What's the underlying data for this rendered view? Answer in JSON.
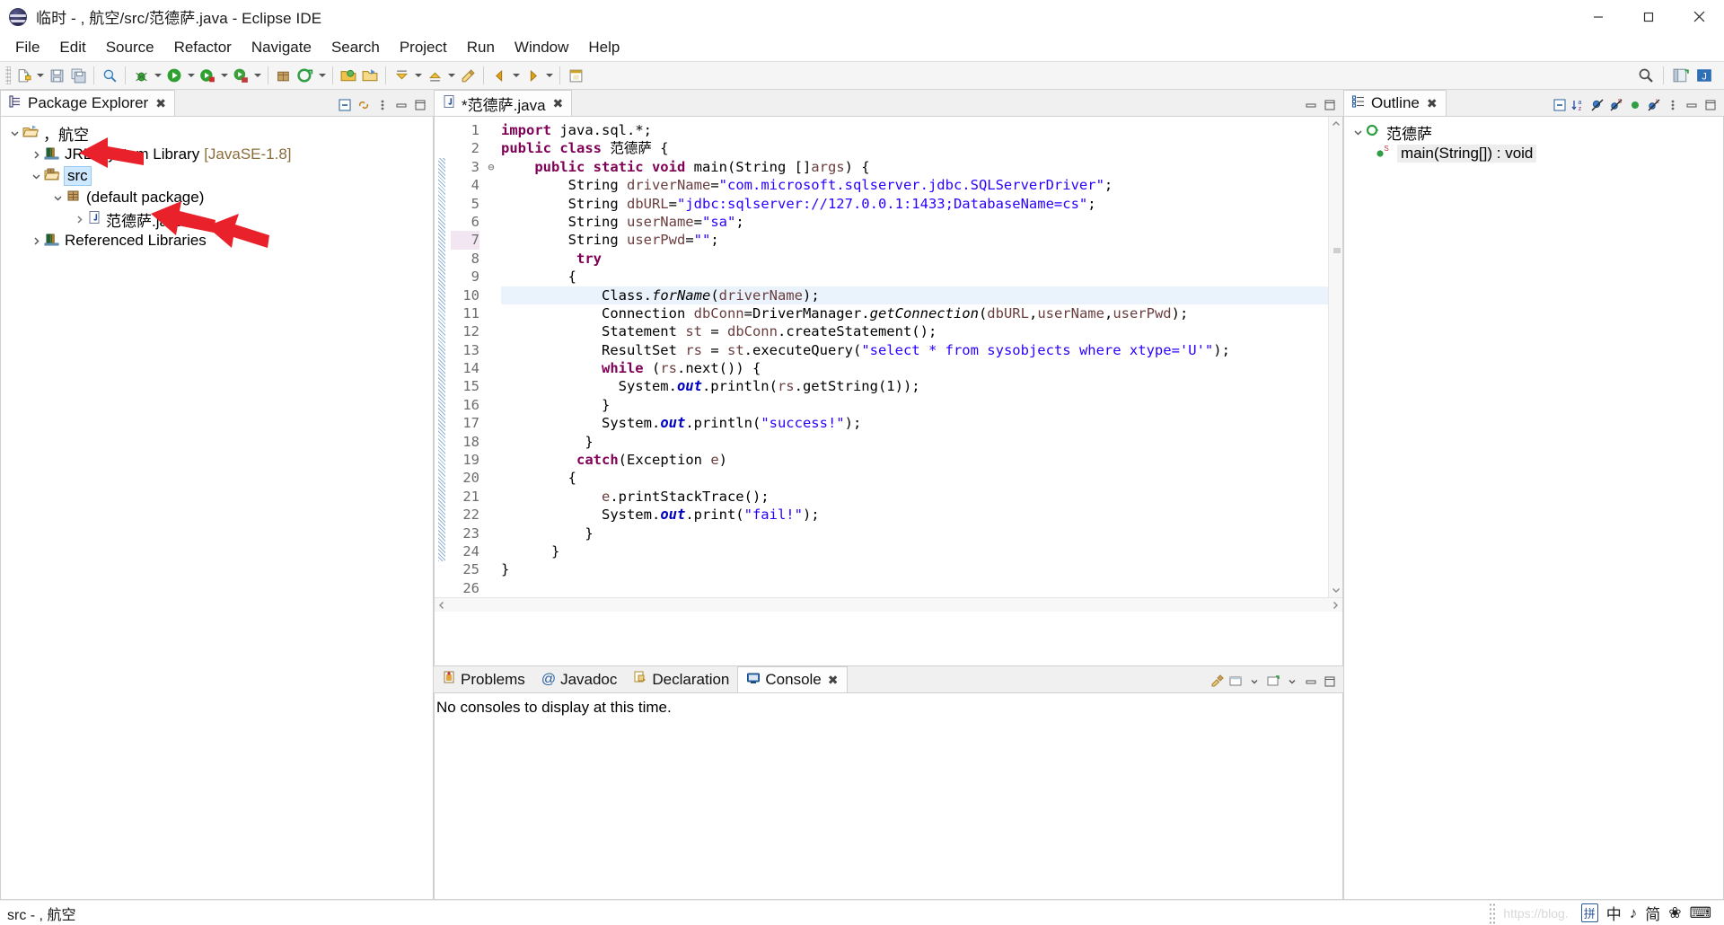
{
  "window": {
    "title": "临时 - ,  航空/src/范德萨.java - Eclipse IDE",
    "icon": "eclipse-icon",
    "minimize": "minimize-button",
    "maximize": "maximize-button",
    "close": "close-button"
  },
  "menubar": {
    "items": [
      "File",
      "Edit",
      "Source",
      "Refactor",
      "Navigate",
      "Search",
      "Project",
      "Run",
      "Window",
      "Help"
    ]
  },
  "package_explorer": {
    "tab_label": "Package Explorer",
    "tree": [
      {
        "label": "，航空",
        "icon": "project-folder-icon",
        "indent": 0,
        "expanded": true,
        "selected": false
      },
      {
        "label": "JRE System Library",
        "suffix": "[JavaSE-1.8]",
        "icon": "library-icon",
        "indent": 1,
        "expanded": false,
        "selected": false
      },
      {
        "label": "src",
        "icon": "source-folder-icon",
        "indent": 1,
        "expanded": true,
        "selected": true
      },
      {
        "label": "(default package)",
        "icon": "package-icon",
        "indent": 2,
        "expanded": true,
        "selected": false
      },
      {
        "label": "范德萨.java",
        "icon": "java-file-icon",
        "indent": 3,
        "expanded": false,
        "selected": false
      },
      {
        "label": "Referenced Libraries",
        "icon": "library-icon",
        "indent": 1,
        "expanded": false,
        "selected": false
      }
    ]
  },
  "editor": {
    "tab_label": "*范德萨.java",
    "dirty": true,
    "current_line": 7,
    "highlight_line": 10,
    "lines": [
      {
        "n": 1,
        "fold": "",
        "tokens": [
          [
            "kw",
            "import"
          ],
          [
            "plain",
            " java.sql.*;"
          ]
        ]
      },
      {
        "n": 2,
        "fold": "",
        "tokens": [
          [
            "kw",
            "public class"
          ],
          [
            "plain",
            " 范德萨 {"
          ]
        ]
      },
      {
        "n": 3,
        "fold": "⊖",
        "tokens": [
          [
            "plain",
            "    "
          ],
          [
            "kw",
            "public static void"
          ],
          [
            "plain",
            " main(String []"
          ],
          [
            "lvar",
            "args"
          ],
          [
            "plain",
            ") {"
          ]
        ]
      },
      {
        "n": 4,
        "fold": "",
        "tokens": [
          [
            "plain",
            "        String "
          ],
          [
            "lvar",
            "driverName"
          ],
          [
            "plain",
            "="
          ],
          [
            "str",
            "\"com.microsoft.sqlserver.jdbc.SQLServerDriver\""
          ],
          [
            "plain",
            ";"
          ]
        ]
      },
      {
        "n": 5,
        "fold": "",
        "tokens": [
          [
            "plain",
            "        String "
          ],
          [
            "lvar",
            "dbURL"
          ],
          [
            "plain",
            "="
          ],
          [
            "str",
            "\"jdbc:sqlserver://127.0.0.1:1433;DatabaseName=cs\""
          ],
          [
            "plain",
            ";"
          ]
        ]
      },
      {
        "n": 6,
        "fold": "",
        "tokens": [
          [
            "plain",
            "        String "
          ],
          [
            "lvar",
            "userName"
          ],
          [
            "plain",
            "="
          ],
          [
            "str",
            "\"sa\""
          ],
          [
            "plain",
            ";"
          ]
        ]
      },
      {
        "n": 7,
        "fold": "",
        "tokens": [
          [
            "plain",
            "        String "
          ],
          [
            "lvar",
            "userPwd"
          ],
          [
            "plain",
            "="
          ],
          [
            "str",
            "\"\""
          ],
          [
            "plain",
            ";"
          ]
        ]
      },
      {
        "n": 8,
        "fold": "",
        "tokens": [
          [
            "plain",
            "         "
          ],
          [
            "kw",
            "try"
          ]
        ]
      },
      {
        "n": 9,
        "fold": "",
        "tokens": [
          [
            "plain",
            "        {"
          ]
        ]
      },
      {
        "n": 10,
        "fold": "",
        "tokens": [
          [
            "plain",
            "            Class."
          ],
          [
            "mth",
            "forName"
          ],
          [
            "plain",
            "("
          ],
          [
            "lvar",
            "driverName"
          ],
          [
            "plain",
            ");"
          ]
        ]
      },
      {
        "n": 11,
        "fold": "",
        "tokens": [
          [
            "plain",
            "            Connection "
          ],
          [
            "lvar",
            "dbConn"
          ],
          [
            "plain",
            "=DriverManager."
          ],
          [
            "mth",
            "getConnection"
          ],
          [
            "plain",
            "("
          ],
          [
            "lvar",
            "dbURL"
          ],
          [
            "plain",
            ","
          ],
          [
            "lvar",
            "userName"
          ],
          [
            "plain",
            ","
          ],
          [
            "lvar",
            "userPwd"
          ],
          [
            "plain",
            ");"
          ]
        ]
      },
      {
        "n": 12,
        "fold": "",
        "tokens": [
          [
            "plain",
            "            Statement "
          ],
          [
            "lvar",
            "st"
          ],
          [
            "plain",
            " = "
          ],
          [
            "lvar",
            "dbConn"
          ],
          [
            "plain",
            ".createStatement();"
          ]
        ]
      },
      {
        "n": 13,
        "fold": "",
        "tokens": [
          [
            "plain",
            "            ResultSet "
          ],
          [
            "lvar",
            "rs"
          ],
          [
            "plain",
            " = "
          ],
          [
            "lvar",
            "st"
          ],
          [
            "plain",
            ".executeQuery("
          ],
          [
            "str",
            "\"select * from sysobjects where xtype='U'\""
          ],
          [
            "plain",
            ");"
          ]
        ]
      },
      {
        "n": 14,
        "fold": "",
        "tokens": [
          [
            "plain",
            "            "
          ],
          [
            "kw",
            "while"
          ],
          [
            "plain",
            " ("
          ],
          [
            "lvar",
            "rs"
          ],
          [
            "plain",
            ".next()) {"
          ]
        ]
      },
      {
        "n": 15,
        "fold": "",
        "tokens": [
          [
            "plain",
            "              System."
          ],
          [
            "sfield",
            "out"
          ],
          [
            "plain",
            ".println("
          ],
          [
            "lvar",
            "rs"
          ],
          [
            "plain",
            ".getString(1));"
          ]
        ]
      },
      {
        "n": 16,
        "fold": "",
        "tokens": [
          [
            "plain",
            "            }"
          ]
        ]
      },
      {
        "n": 17,
        "fold": "",
        "tokens": [
          [
            "plain",
            "            System."
          ],
          [
            "sfield",
            "out"
          ],
          [
            "plain",
            ".println("
          ],
          [
            "str",
            "\"success!\""
          ],
          [
            "plain",
            ");"
          ]
        ]
      },
      {
        "n": 18,
        "fold": "",
        "tokens": [
          [
            "plain",
            "          }"
          ]
        ]
      },
      {
        "n": 19,
        "fold": "",
        "tokens": [
          [
            "plain",
            "         "
          ],
          [
            "kw",
            "catch"
          ],
          [
            "plain",
            "(Exception "
          ],
          [
            "lvar",
            "e"
          ],
          [
            "plain",
            ")"
          ]
        ]
      },
      {
        "n": 20,
        "fold": "",
        "tokens": [
          [
            "plain",
            "        {"
          ]
        ]
      },
      {
        "n": 21,
        "fold": "",
        "tokens": [
          [
            "plain",
            "            "
          ],
          [
            "lvar",
            "e"
          ],
          [
            "plain",
            ".printStackTrace();"
          ]
        ]
      },
      {
        "n": 22,
        "fold": "",
        "tokens": [
          [
            "plain",
            "            System."
          ],
          [
            "sfield",
            "out"
          ],
          [
            "plain",
            ".print("
          ],
          [
            "str",
            "\"fail!\""
          ],
          [
            "plain",
            ");"
          ]
        ]
      },
      {
        "n": 23,
        "fold": "",
        "tokens": [
          [
            "plain",
            "          }"
          ]
        ]
      },
      {
        "n": 24,
        "fold": "",
        "tokens": [
          [
            "plain",
            "      }"
          ]
        ]
      },
      {
        "n": 25,
        "fold": "",
        "tokens": [
          [
            "plain",
            "}"
          ]
        ]
      },
      {
        "n": 26,
        "fold": "",
        "tokens": [
          [
            "plain",
            ""
          ]
        ]
      }
    ]
  },
  "outline": {
    "tab_label": "Outline",
    "items": [
      {
        "label": "范德萨",
        "icon": "class-icon",
        "indent": 0,
        "expanded": true,
        "selected": false
      },
      {
        "label": "main(String[]) : void",
        "icon": "method-public-static-icon",
        "indent": 1,
        "expanded": false,
        "selected": true
      }
    ]
  },
  "bottom_panel": {
    "tabs": [
      {
        "label": "Problems",
        "icon": "problems-icon",
        "active": false
      },
      {
        "label": "Javadoc",
        "icon": "javadoc-icon",
        "active": false
      },
      {
        "label": "Declaration",
        "icon": "declaration-icon",
        "active": false
      },
      {
        "label": "Console",
        "icon": "console-icon",
        "active": true
      }
    ],
    "console_message": "No consoles to display at this time."
  },
  "statusbar": {
    "left": "src - ,  航空",
    "watermark": "https://blog.",
    "ime": {
      "mode_a": "拼",
      "mode_b": "中",
      "music": "♪",
      "shape": "简",
      "flower": "❀",
      "keyboard": "⌨"
    }
  },
  "colors": {
    "keyword": "#7f0055",
    "string": "#2a00ff",
    "selection": "#cde8ff",
    "line_highlight": "#eaf2fb",
    "arrow": "#e8212a"
  }
}
